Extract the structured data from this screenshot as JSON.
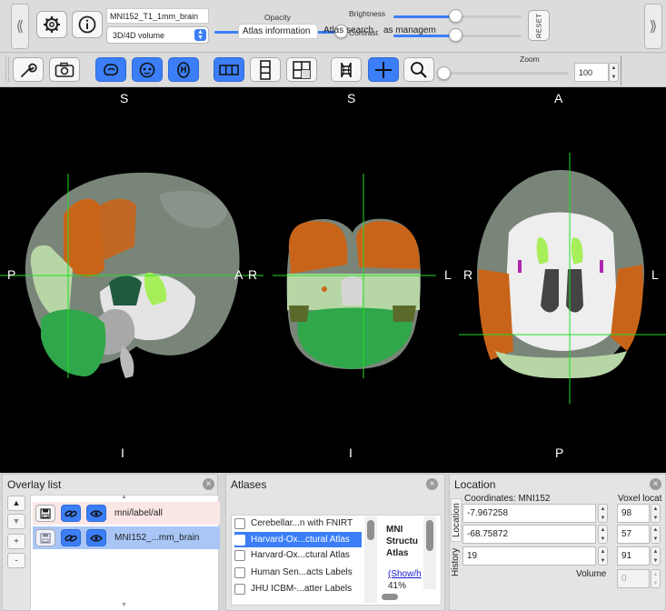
{
  "toolbar": {
    "image_name": "MNI152_T1_1mm_brain",
    "volume_type": "3D/4D volume",
    "opacity_label": "Opacity",
    "opacity": 0.99,
    "brightness_label": "Brightness",
    "brightness": 0.48,
    "contrast_label": "Contrast",
    "contrast": 0.48,
    "reset_label": "RESET",
    "zoom_label": "Zoom",
    "zoom_value": "100",
    "zoom_slider": 0.0,
    "icons": [
      "gear-icon",
      "info-icon",
      "wrench-icon",
      "camera-icon",
      "sagittal-brain-icon",
      "coronal-brain-icon",
      "axial-brain-icon",
      "horizontal-layout-icon",
      "vertical-layout-icon",
      "grid-layout-icon",
      "movie-icon",
      "crosshair-icon",
      "magnifier-icon"
    ]
  },
  "viewer": {
    "sagittal": {
      "top": "S",
      "bottom": "I",
      "left": "P",
      "right": "A"
    },
    "coronal": {
      "top": "S",
      "bottom": "I",
      "left": "R",
      "right": "L"
    },
    "axial": {
      "top": "A",
      "bottom": "P",
      "left": "R",
      "right": "L"
    },
    "crosshair_color": "#22dd22"
  },
  "overlay": {
    "title": "Overlay list",
    "buttons": [
      "▲",
      "▼",
      "+",
      "-"
    ],
    "items": [
      {
        "name": "mni/label/all"
      },
      {
        "name": "MNI152_...mm_brain"
      }
    ]
  },
  "atlases": {
    "title": "Atlases",
    "tabs": [
      "Atlas information",
      "Atlas search",
      "as managem"
    ],
    "list": [
      "Cerebellar...n with FNIRT",
      "Harvard-Ox...ctural Atlas",
      "Harvard-Ox...ctural Atlas",
      "Human Sen...acts Labels",
      "JHU ICBM-...atter Labels"
    ],
    "info_title": "MNI Structu Atlas",
    "info_link": "(Show/h",
    "info_pct": "41%"
  },
  "location": {
    "title": "Location",
    "coords_label": "Coordinates: MNI152",
    "voxel_label": "Voxel locat",
    "side_tabs": [
      "Location",
      "History"
    ],
    "coords": [
      "-7.967258",
      "-68.75872",
      "19"
    ],
    "voxels": [
      "98",
      "57",
      "91"
    ],
    "volume_label": "Volume",
    "volume_value": "0"
  }
}
